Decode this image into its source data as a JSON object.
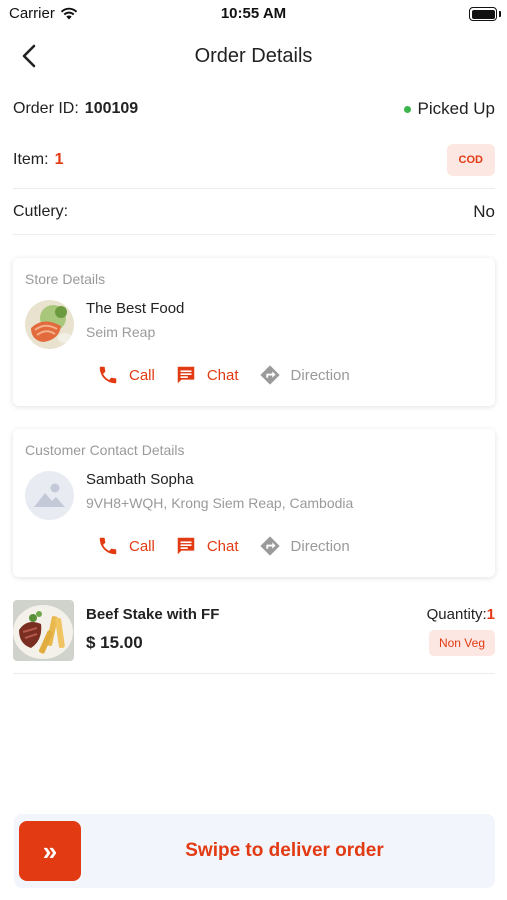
{
  "status_bar": {
    "carrier": "Carrier",
    "time": "10:55 AM"
  },
  "nav": {
    "title": "Order Details"
  },
  "order": {
    "id_label": "Order ID:",
    "id_value": "100109",
    "status": "Picked Up",
    "status_color": "#3bb54a",
    "item_label": "Item:",
    "item_value": "1",
    "payment_badge": "COD",
    "cutlery_label": "Cutlery:",
    "cutlery_value": "No"
  },
  "store": {
    "section_title": "Store Details",
    "name": "The Best Food",
    "location": "Seim Reap",
    "actions": {
      "call": "Call",
      "chat": "Chat",
      "direction": "Direction"
    }
  },
  "customer": {
    "section_title": "Customer Contact Details",
    "name": "Sambath Sopha",
    "address": "9VH8+WQH, Krong Siem Reap, Cambodia",
    "actions": {
      "call": "Call",
      "chat": "Chat",
      "direction": "Direction"
    }
  },
  "items": [
    {
      "name": "Beef Stake with FF",
      "price": "$ 15.00",
      "quantity_label": "Quantity:",
      "quantity": "1",
      "tag": "Non Veg"
    }
  ],
  "swipe": {
    "label": "Swipe to deliver order",
    "handle_glyph": "»"
  },
  "colors": {
    "accent": "#e23a13",
    "muted": "#9a9a9a",
    "badge_bg": "#fde7e2"
  }
}
